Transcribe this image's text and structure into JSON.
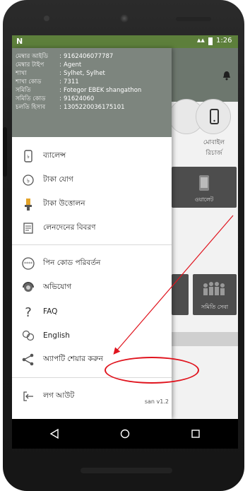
{
  "status_bar": {
    "notification_icon": "N",
    "time": "1:26"
  },
  "member_info": [
    {
      "label": "মেম্বার আইডি",
      "value": "9162406077787"
    },
    {
      "label": "মেম্বার টাইপ",
      "value": "Agent"
    },
    {
      "label": "শাখা",
      "value": "Sylhet, Sylhet"
    },
    {
      "label": "শাখা কোড",
      "value": "7311"
    },
    {
      "label": "সমিতি",
      "value": "Fotegor EBEK shangathon"
    },
    {
      "label": "সমিতি কোড",
      "value": "91624060"
    },
    {
      "label": "চলতি হিসাব",
      "value": "1305220036175101"
    }
  ],
  "menu_items": [
    {
      "id": "balance",
      "label": "ব্যালেন্স",
      "icon": "phone-balance-icon"
    },
    {
      "id": "deposit",
      "label": "টাকা যোগ",
      "icon": "taka-add-icon"
    },
    {
      "id": "withdraw",
      "label": "টাকা উত্তোলন",
      "icon": "money-hand-icon"
    },
    {
      "id": "transactions",
      "label": "লেনদেনের বিবরণ",
      "icon": "statement-icon"
    },
    {
      "id": "pin",
      "label": "পিন কোড পরিবর্তন",
      "icon": "pin-icon"
    },
    {
      "id": "complaint",
      "label": "অভিযোগ",
      "icon": "support-icon"
    },
    {
      "id": "faq",
      "label": "FAQ",
      "icon": "question-icon"
    },
    {
      "id": "language",
      "label": "English",
      "icon": "language-icon"
    },
    {
      "id": "share",
      "label": "অ্যাপটি শেয়ার করুন",
      "icon": "share-icon"
    },
    {
      "id": "logout",
      "label": "লগ আউট",
      "icon": "logout-icon"
    }
  ],
  "version": "san v1.2",
  "background_app": {
    "mobile_recharge_label": "মোবাইল রিচার্জ",
    "tile_label": "ওয়ালেট",
    "samity_service_label": "সমিতি সেবা"
  },
  "colors": {
    "status_bar": "#5d7f3b",
    "drawer_header": "#7d857e",
    "annotation": "#e0141e"
  }
}
